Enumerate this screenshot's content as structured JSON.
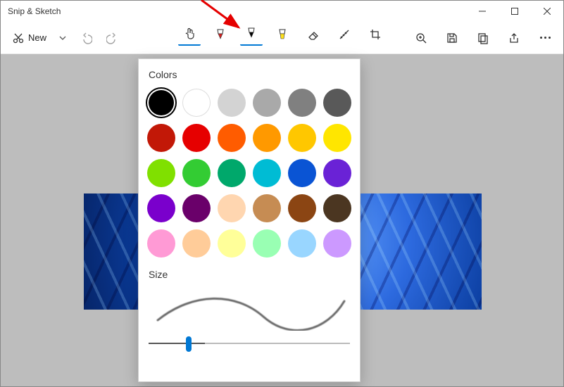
{
  "window": {
    "title": "Snip & Sketch"
  },
  "toolbar": {
    "new_label": "New"
  },
  "flyout": {
    "colors_label": "Colors",
    "size_label": "Size",
    "selected_index": 0,
    "colors": [
      "#000000",
      "#ffffff",
      "#d3d3d3",
      "#a9a9a9",
      "#808080",
      "#595959",
      "#c21807",
      "#e60000",
      "#ff5c00",
      "#ff9900",
      "#ffc700",
      "#ffe600",
      "#80e000",
      "#33cc33",
      "#00a86b",
      "#00bcd4",
      "#0a54d4",
      "#6a22d6",
      "#7a00cc",
      "#6a006a",
      "#ffd6b0",
      "#c68c53",
      "#8b4513",
      "#4b3621",
      "#ff9ad5",
      "#ffcc99",
      "#ffff99",
      "#99ffb3",
      "#99d6ff",
      "#cc99ff"
    ],
    "size_value": 18,
    "size_min": 1,
    "size_max": 100
  }
}
